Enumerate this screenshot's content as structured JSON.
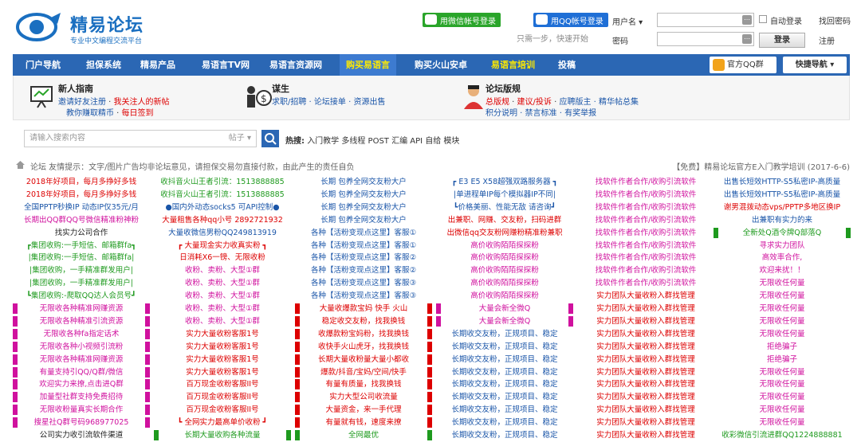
{
  "header": {
    "logo_title": "精易论坛",
    "logo_subtitle": "专业中文编程交流平台",
    "wechat_login": "用微信帐号登录",
    "qq_login": "用QQ帐号登录",
    "hint": "只需一步，快速开始",
    "username_label": "用户名",
    "password_label": "密码",
    "auto_login": "自动登录",
    "find_password": "找回密码",
    "login_button": "登录",
    "register": "注册"
  },
  "nav": {
    "items": [
      "门户导航",
      "担保系统",
      "精易产品",
      "易语言TV网",
      "易语言资源网",
      "购买易语言",
      "购买火山安卓",
      "易语言培训",
      "投稿"
    ],
    "qq_group": "官方QQ群",
    "quick_nav": "快捷导航"
  },
  "info": {
    "newbie": {
      "title": "新人指南",
      "line1a": "邀请好友注册",
      "line1b": "我关注人的新帖",
      "line2a": "教你赚取精币",
      "line2b": "每日签到"
    },
    "job": {
      "title": "谋生",
      "line1": "求职/招聘 · 论坛接单 · 资源出售"
    },
    "rules": {
      "title": "论坛版规",
      "line1a": "总版规",
      "line1b": "建议/投诉",
      "line1c": "应聘版主 · 精华帖总集",
      "line2": "积分说明 · 禁言标准 · 有奖举报"
    }
  },
  "search": {
    "placeholder": "请输入搜索内容",
    "type": "帖子",
    "hot_label": "热搜:",
    "hot_words": "入门教学 多线程 POST 汇编 API 自给 模块"
  },
  "breadcrumb": {
    "text": "论坛   友情提示：文字/图片广告均非论坛意见，请担保交易勿直接付款，由此产生的责任自负",
    "right": "【免费】精易论坛官方E入门教学培训  (2017-6-6)"
  },
  "ads": {
    "columns": [
      {
        "items": [
          {
            "t": "2018年好项目，每月多挣好多钱",
            "c": "#d00"
          },
          {
            "t": "2018年好项目，每月多挣好多钱",
            "c": "#d00"
          },
          {
            "t": "全国PPTP秒换IP 动态IP仅35元/月",
            "c": "#1a55a8"
          },
          {
            "t": "长期出QQ群QQ号微信精准粉神粉",
            "c": "#d0119e"
          },
          {
            "t": "找实力公司合作",
            "c": "#222"
          },
          {
            "t": "┏集团收购:一手短信、邮箱群fa┓",
            "c": "#1e9a1e"
          },
          {
            "t": "|集团收购:一手短信、邮箱群fa|",
            "c": "#1e9a1e"
          },
          {
            "t": "|集团收购，一手精准群发用户|",
            "c": "#1e9a1e"
          },
          {
            "t": "|集团收购，一手精准群发用户|",
            "c": "#1e9a1e"
          },
          {
            "t": "┗集团收购:-爬取QQ达人会员号┛",
            "c": "#1e9a1e"
          },
          {
            "t": "无限收各种精准网赚资源",
            "c": "#d0119e",
            "bg": "#d0119e"
          },
          {
            "t": "无限收各种精准引流资源",
            "c": "#d0119e",
            "bg": "#d0119e"
          },
          {
            "t": "无限收各种fa指定话术",
            "c": "#d0119e",
            "bg": "#d0119e"
          },
          {
            "t": "无限收各种小视频引流粉",
            "c": "#d0119e",
            "bg": "#d0119e"
          },
          {
            "t": "无限收各种精准网赚资源",
            "c": "#d0119e",
            "bg": "#d0119e"
          },
          {
            "t": "有量支持引QQ/Q群/微信",
            "c": "#d0119e",
            "bg": "#d0119e"
          },
          {
            "t": "欢迎实力来撩,点击进Q群",
            "c": "#d0119e",
            "bg": "#d0119e"
          },
          {
            "t": "加量型社群支持免费招待",
            "c": "#d0119e",
            "bg": "#d0119e"
          },
          {
            "t": "无限收粉量真实长期合作",
            "c": "#d0119e",
            "bg": "#d0119e"
          },
          {
            "t": "搜星社Q群号码968977025",
            "c": "#d0119e",
            "bg": "#d0119e"
          },
          {
            "t": "公司实力收引流软件渠道",
            "c": "#222"
          }
        ]
      },
      {
        "items": [
          {
            "t": "收抖音火山王者引流：1513888885",
            "c": "#1e9a1e"
          },
          {
            "t": "收抖音火山王者引流：1513888885",
            "c": "#1e9a1e"
          },
          {
            "t": "●国内外动态socks5 可API控制●",
            "c": "#1a55a8"
          },
          {
            "t": "大量租售各种qq小号 2892721932",
            "c": "#d00"
          },
          {
            "t": "大量收微信男粉QQ249813919",
            "c": "#1a55a8"
          },
          {
            "t": "┏ 大量现金实力收真实粉 ┓",
            "c": "#d00"
          },
          {
            "t": "日消耗X6一镑、无限收粉",
            "c": "#d00"
          },
          {
            "t": "收粉、卖粉、大型①群",
            "c": "#d0119e"
          },
          {
            "t": "收粉、卖粉、大型①群",
            "c": "#d0119e"
          },
          {
            "t": "收粉、卖粉、大型①群",
            "c": "#d0119e"
          },
          {
            "t": "收粉、卖粉、大型①群",
            "c": "#d0119e"
          },
          {
            "t": "收粉、卖粉、大型①群",
            "c": "#d0119e"
          },
          {
            "t": "实力大量收粉客服1号",
            "c": "#d00"
          },
          {
            "t": "实力大量收粉客服1号",
            "c": "#d00"
          },
          {
            "t": "实力大量收粉客服1号",
            "c": "#d00"
          },
          {
            "t": "实力大量收粉客服1号",
            "c": "#d00"
          },
          {
            "t": "百万现金收粉客服II号",
            "c": "#d00"
          },
          {
            "t": "百万现金收粉客服II号",
            "c": "#d00"
          },
          {
            "t": "百万现金收粉客服II号",
            "c": "#d00"
          },
          {
            "t": "┗ 全网实力最高单价收粉 ┛",
            "c": "#d00"
          },
          {
            "t": "长期大量收购各种流量",
            "c": "#1e9a1e",
            "bg": "#1e9a1e"
          }
        ]
      },
      {
        "items": [
          {
            "t": "长期 包养全网交友粉大户",
            "c": "#1a55a8"
          },
          {
            "t": "长期 包养全网交友粉大户",
            "c": "#1a55a8"
          },
          {
            "t": "长期 包养全网交友粉大户",
            "c": "#1a55a8"
          },
          {
            "t": "长期 包养全网交友粉大户",
            "c": "#1a55a8"
          },
          {
            "t": "各种【活粉变现点这里】客服①",
            "c": "#1a55a8"
          },
          {
            "t": "各种【活粉变现点这里】客服①",
            "c": "#1a55a8"
          },
          {
            "t": "各种【活粉变现点这里】客服②",
            "c": "#1a55a8"
          },
          {
            "t": "各种【活粉变现点这里】客服②",
            "c": "#1a55a8"
          },
          {
            "t": "各种【活粉变现点这里】客服③",
            "c": "#1a55a8"
          },
          {
            "t": "各种【活粉变现点这里】客服③",
            "c": "#1a55a8"
          },
          {
            "t": "大量收爆款宝妈 快手 火山",
            "c": "#d00",
            "bg": "#d00"
          },
          {
            "t": "稳定收交友粉，找我换钱",
            "c": "#d00",
            "bg": "#d00"
          },
          {
            "t": "收爆款粉宝妈粉，找我换钱",
            "c": "#d00",
            "bg": "#d00"
          },
          {
            "t": "收快手火山虎牙，找我换钱",
            "c": "#d00",
            "bg": "#d00"
          },
          {
            "t": "长期大量收粉量大量小都收",
            "c": "#d00",
            "bg": "#d00"
          },
          {
            "t": "爆款/抖音/宝妈/空间/快手",
            "c": "#d00",
            "bg": "#d00"
          },
          {
            "t": "有量有质量，找我换钱",
            "c": "#d00",
            "bg": "#d00"
          },
          {
            "t": "实力大型公司收流量",
            "c": "#d00",
            "bg": "#d00"
          },
          {
            "t": "大量资金，来一手代理",
            "c": "#d00",
            "bg": "#d00"
          },
          {
            "t": "有量就有钱，速度来撩",
            "c": "#d00",
            "bg": "#d00"
          },
          {
            "t": "全网最优",
            "c": "#1e9a1e",
            "bg": "#1e9a1e"
          }
        ]
      },
      {
        "items": [
          {
            "t": "┏ E3 E5 X58超强双路服务器 ┓",
            "c": "#1a55a8"
          },
          {
            "t": "|单进程单IP每个模拟器IP不同|",
            "c": "#1a55a8"
          },
          {
            "t": "┗价格美丽、性能无敌 请咨询┛",
            "c": "#1a55a8"
          },
          {
            "t": "出兼职、网赚、交友粉，扫码进群",
            "c": "#d00"
          },
          {
            "t": "出微信qq交友粉网赚粉精准粉兼职",
            "c": "#d00"
          },
          {
            "t": "高价收购陌陌探探粉",
            "c": "#d0119e"
          },
          {
            "t": "高价收购陌陌探探粉",
            "c": "#d0119e"
          },
          {
            "t": "高价收购陌陌探探粉",
            "c": "#d0119e"
          },
          {
            "t": "高价收购陌陌探探粉",
            "c": "#d0119e"
          },
          {
            "t": "高价收购陌陌探探粉",
            "c": "#d0119e"
          },
          {
            "t": "大量会新全微Q",
            "c": "#d0119e",
            "bg": "#d0119e"
          },
          {
            "t": "大量会新全微Q",
            "c": "#d0119e",
            "bg": "#d0119e"
          },
          {
            "t": "长期收交友粉，正规项目、稳定",
            "c": "#1a55a8"
          },
          {
            "t": "长期收交友粉，正规项目、稳定",
            "c": "#1a55a8"
          },
          {
            "t": "长期收交友粉，正规项目、稳定",
            "c": "#1a55a8"
          },
          {
            "t": "长期收交友粉，正规项目、稳定",
            "c": "#1a55a8"
          },
          {
            "t": "长期收交友粉，正规项目、稳定",
            "c": "#1a55a8"
          },
          {
            "t": "长期收交友粉，正规项目、稳定",
            "c": "#1a55a8"
          },
          {
            "t": "长期收交友粉，正规项目、稳定",
            "c": "#1a55a8"
          },
          {
            "t": "长期收交友粉，正规项目、稳定",
            "c": "#1a55a8"
          },
          {
            "t": "长期收交友粉，正规项目、稳定",
            "c": "#1a55a8"
          }
        ]
      },
      {
        "items": [
          {
            "t": "找软件作者合作/收购引流软件",
            "c": "#d0119e"
          },
          {
            "t": "找软件作者合作/收购引流软件",
            "c": "#d0119e"
          },
          {
            "t": "找软件作者合作/收购引流软件",
            "c": "#d0119e"
          },
          {
            "t": "找软件作者合作/收购引流软件",
            "c": "#d0119e"
          },
          {
            "t": "找软件作者合作/收购引流软件",
            "c": "#d0119e"
          },
          {
            "t": "找软件作者合作/收购引流软件",
            "c": "#d0119e"
          },
          {
            "t": "找软件作者合作/收购引流软件",
            "c": "#d0119e"
          },
          {
            "t": "找软件作者合作/收购引流软件",
            "c": "#d0119e"
          },
          {
            "t": "找软件作者合作/收购引流软件",
            "c": "#d0119e"
          },
          {
            "t": "实力团队大量收粉入群找管理",
            "c": "#d00"
          },
          {
            "t": "实力团队大量收粉入群找管理",
            "c": "#d00"
          },
          {
            "t": "实力团队大量收粉入群找管理",
            "c": "#d00"
          },
          {
            "t": "实力团队大量收粉入群找管理",
            "c": "#d00"
          },
          {
            "t": "实力团队大量收粉入群找管理",
            "c": "#d00"
          },
          {
            "t": "实力团队大量收粉入群找管理",
            "c": "#d00"
          },
          {
            "t": "实力团队大量收粉入群找管理",
            "c": "#d00"
          },
          {
            "t": "实力团队大量收粉入群找管理",
            "c": "#d00"
          },
          {
            "t": "实力团队大量收粉入群找管理",
            "c": "#d00"
          },
          {
            "t": "实力团队大量收粉入群找管理",
            "c": "#d00"
          },
          {
            "t": "实力团队大量收粉入群找管理",
            "c": "#d00"
          },
          {
            "t": "实力团队大量收粉入群找管理",
            "c": "#d00"
          }
        ]
      },
      {
        "items": [
          {
            "t": "出售长短效HTTP-S5私密IP-高质量",
            "c": "#1a55a8"
          },
          {
            "t": "出售长短效HTTP-S5私密IP-高质量",
            "c": "#1a55a8"
          },
          {
            "t": "谢男混拨动态vps/PPTP多地区换IP",
            "c": "#d00"
          },
          {
            "t": "出兼职有实力的来",
            "c": "#1a55a8"
          },
          {
            "t": "全新处Q酒令牌Q部落Q",
            "c": "#1e9a1e",
            "bg": "#1e9a1e"
          },
          {
            "t": "寻求实力团队",
            "c": "#d0119e"
          },
          {
            "t": "高效率合作,",
            "c": "#d0119e"
          },
          {
            "t": "欢迎来扰！！",
            "c": "#d0119e"
          },
          {
            "t": "无限收任何量",
            "c": "#d0119e"
          },
          {
            "t": "无限收任何量",
            "c": "#d0119e"
          },
          {
            "t": "无限收任何量",
            "c": "#d0119e"
          },
          {
            "t": "无限收任何量",
            "c": "#d0119e"
          },
          {
            "t": "无限收任何量",
            "c": "#d0119e"
          },
          {
            "t": "拒绝骗子",
            "c": "#d0119e"
          },
          {
            "t": "拒绝骗子",
            "c": "#d0119e"
          },
          {
            "t": "无限收任何量",
            "c": "#d0119e"
          },
          {
            "t": "无限收任何量",
            "c": "#d0119e"
          },
          {
            "t": "无限收任何量",
            "c": "#d0119e"
          },
          {
            "t": "无限收任何量",
            "c": "#d0119e"
          },
          {
            "t": "无限收任何量",
            "c": "#d0119e"
          },
          {
            "t": "收彩微信引流进群QQ1224888881",
            "c": "#1e9a1e"
          }
        ]
      }
    ]
  }
}
